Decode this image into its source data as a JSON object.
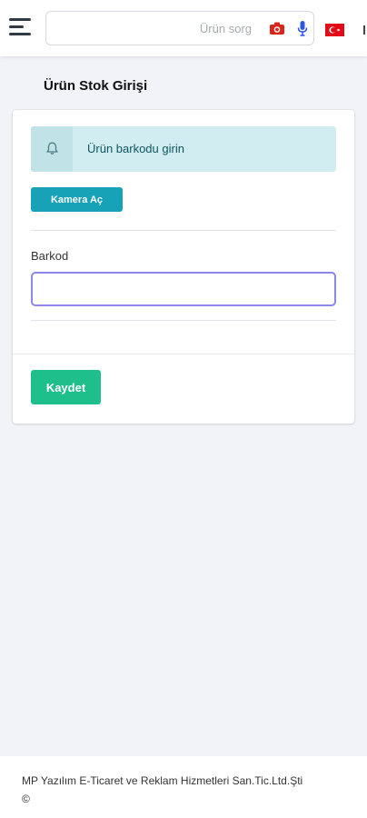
{
  "header": {
    "search": {
      "placeholder": "Ürün sorg",
      "value": ""
    }
  },
  "page": {
    "title": "Ürün Stok Girişi"
  },
  "alert": {
    "text": "Ürün barkodu girin",
    "icon": "bell-icon"
  },
  "camera_button": {
    "label": "Kamera Aç"
  },
  "barcode_field": {
    "label": "Barkod",
    "value": ""
  },
  "save_button": {
    "label": "Kaydet"
  },
  "footer": {
    "company": "MP Yazılım E-Ticaret ve Reklam Hizmetleri San.Tic.Ltd.Şti",
    "copyright": "©"
  },
  "colors": {
    "info": "#17a2b8",
    "success": "#1fbf8c",
    "alert_bg": "#d1edf1",
    "camera_icon": "#d9251c",
    "mic_icon": "#2f55e0",
    "flag": "#e30a17"
  },
  "icons": [
    "menu-icon",
    "camera-icon",
    "microphone-icon",
    "turkey-flag-icon",
    "bell-icon"
  ]
}
